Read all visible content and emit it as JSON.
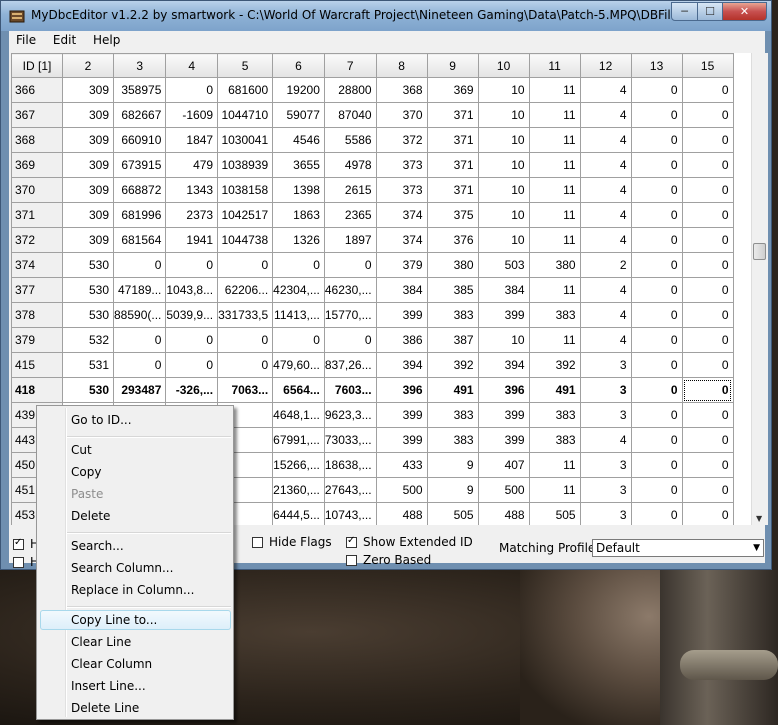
{
  "window": {
    "title": "MyDbcEditor v1.2.2 by smartwork - C:\\World Of Warcraft Project\\Nineteen Gaming\\Data\\Patch-5.MPQ\\DBFilesClient\\...",
    "minimize": "─",
    "maximize": "☐",
    "close": "✕"
  },
  "menu": {
    "file": "File",
    "edit": "Edit",
    "help": "Help"
  },
  "grid": {
    "columns": [
      "ID [1]",
      "2",
      "3",
      "4",
      "5",
      "6",
      "7",
      "8",
      "9",
      "10",
      "11",
      "12",
      "13",
      "15"
    ],
    "rows": [
      [
        "366",
        "309",
        "358975",
        "0",
        "681600",
        "19200",
        "28800",
        "368",
        "369",
        "10",
        "11",
        "4",
        "0",
        "0"
      ],
      [
        "367",
        "309",
        "682667",
        "-1609",
        "1044710",
        "59077",
        "87040",
        "370",
        "371",
        "10",
        "11",
        "4",
        "0",
        "0"
      ],
      [
        "368",
        "309",
        "660910",
        "1847",
        "1030041",
        "4546",
        "5586",
        "372",
        "371",
        "10",
        "11",
        "4",
        "0",
        "0"
      ],
      [
        "369",
        "309",
        "673915",
        "479",
        "1038939",
        "3655",
        "4978",
        "373",
        "371",
        "10",
        "11",
        "4",
        "0",
        "0"
      ],
      [
        "370",
        "309",
        "668872",
        "1343",
        "1038158",
        "1398",
        "2615",
        "373",
        "371",
        "10",
        "11",
        "4",
        "0",
        "0"
      ],
      [
        "371",
        "309",
        "681996",
        "2373",
        "1042517",
        "1863",
        "2365",
        "374",
        "375",
        "10",
        "11",
        "4",
        "0",
        "0"
      ],
      [
        "372",
        "309",
        "681564",
        "1941",
        "1044738",
        "1326",
        "1897",
        "374",
        "376",
        "10",
        "11",
        "4",
        "0",
        "0"
      ],
      [
        "374",
        "530",
        "0",
        "0",
        "0",
        "0",
        "0",
        "379",
        "380",
        "503",
        "380",
        "2",
        "0",
        "0"
      ],
      [
        "377",
        "530",
        "47189...",
        "1043,8...",
        "62206...",
        "42304,...",
        "46230,...",
        "384",
        "385",
        "384",
        "11",
        "4",
        "0",
        "0"
      ],
      [
        "378",
        "530",
        "88590(...",
        "5039,9...",
        "331733,5",
        "11413,...",
        "15770,...",
        "399",
        "383",
        "399",
        "383",
        "4",
        "0",
        "0"
      ],
      [
        "379",
        "532",
        "0",
        "0",
        "0",
        "0",
        "0",
        "386",
        "387",
        "10",
        "11",
        "4",
        "0",
        "0"
      ],
      [
        "415",
        "531",
        "0",
        "0",
        "0",
        "479,60...",
        "837,26...",
        "394",
        "392",
        "394",
        "392",
        "3",
        "0",
        "0"
      ],
      [
        "418",
        "530",
        "293487",
        "-326,...",
        "7063...",
        "6564...",
        "7603...",
        "396",
        "491",
        "396",
        "491",
        "3",
        "0",
        "0"
      ],
      [
        "439",
        "",
        "",
        "87...",
        "",
        "4648,1...",
        "9623,3...",
        "399",
        "383",
        "399",
        "383",
        "3",
        "0",
        "0"
      ],
      [
        "443",
        "",
        "",
        "483...",
        "",
        "67991,...",
        "73033,...",
        "399",
        "383",
        "399",
        "383",
        "4",
        "0",
        "0"
      ],
      [
        "450",
        "",
        "",
        "527...",
        "",
        "15266,...",
        "18638,...",
        "433",
        "9",
        "407",
        "11",
        "3",
        "0",
        "0"
      ],
      [
        "451",
        "",
        "",
        "555...",
        "",
        "21360,...",
        "27643,...",
        "500",
        "9",
        "500",
        "11",
        "3",
        "0",
        "0"
      ],
      [
        "453",
        "",
        "",
        "295...",
        "",
        "6444,5...",
        "10743,...",
        "488",
        "505",
        "488",
        "505",
        "3",
        "0",
        "0"
      ]
    ]
  },
  "options": {
    "hide_flags": "Hide Flags",
    "show_extended_id": "Show Extended ID",
    "zero_based": "Zero Based",
    "left_partial_1": "H",
    "left_partial_2": "H"
  },
  "profiles": {
    "label": "Matching Profiles:",
    "selected": "Default"
  },
  "context_menu": {
    "go_to_id": "Go to ID...",
    "cut": "Cut",
    "copy": "Copy",
    "paste": "Paste",
    "delete": "Delete",
    "search": "Search...",
    "search_column": "Search Column...",
    "replace_in_column": "Replace in Column...",
    "copy_line_to": "Copy Line to...",
    "clear_line": "Clear Line",
    "clear_column": "Clear Column",
    "insert_line": "Insert Line...",
    "delete_line": "Delete Line"
  }
}
